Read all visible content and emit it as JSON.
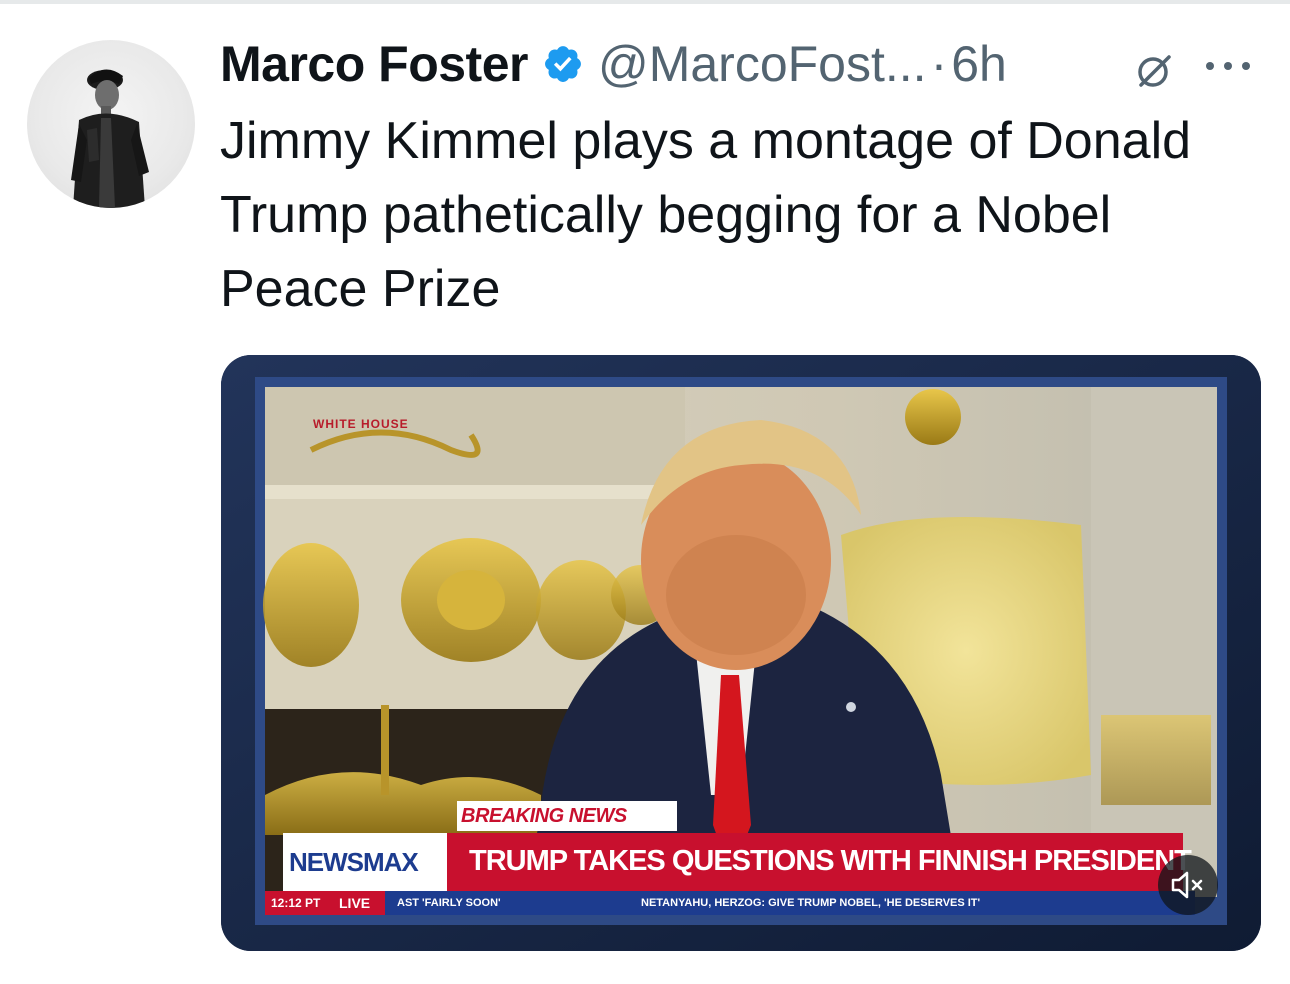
{
  "tweet": {
    "display_name": "Marco Foster",
    "handle": "@MarcoFost...",
    "separator": "·",
    "time": "6h",
    "text": "Jimmy Kimmel plays a montage of Donald Trump pathetically begging for a Nobel Peace Prize",
    "verified": true,
    "icons": {
      "verified": "verified-badge-icon",
      "grok": "grok-icon",
      "more": "more-icon",
      "mute": "volume-mute-icon"
    },
    "colors": {
      "verified": "#1d9bf0",
      "secondary": "#536471",
      "primary": "#0f1419"
    }
  },
  "media": {
    "corner_tag": "WHITE HOUSE",
    "breaking_label": "BREAKING NEWS",
    "channel": "NEWSMAX",
    "headline": "TRUMP TAKES QUESTIONS WITH FINNISH PRESIDENT",
    "ticker_time": "12:12 PT",
    "ticker_live": "LIVE",
    "ticker_1": "AST 'FAIRLY SOON'",
    "ticker_2": "NETANYAHU, HERZOG: GIVE TRUMP NOBEL, 'HE DESERVES IT'",
    "colors": {
      "headline_bar": "#c8102e",
      "channel_box": "#ffffff",
      "ticker": "#1d3c8f"
    }
  }
}
